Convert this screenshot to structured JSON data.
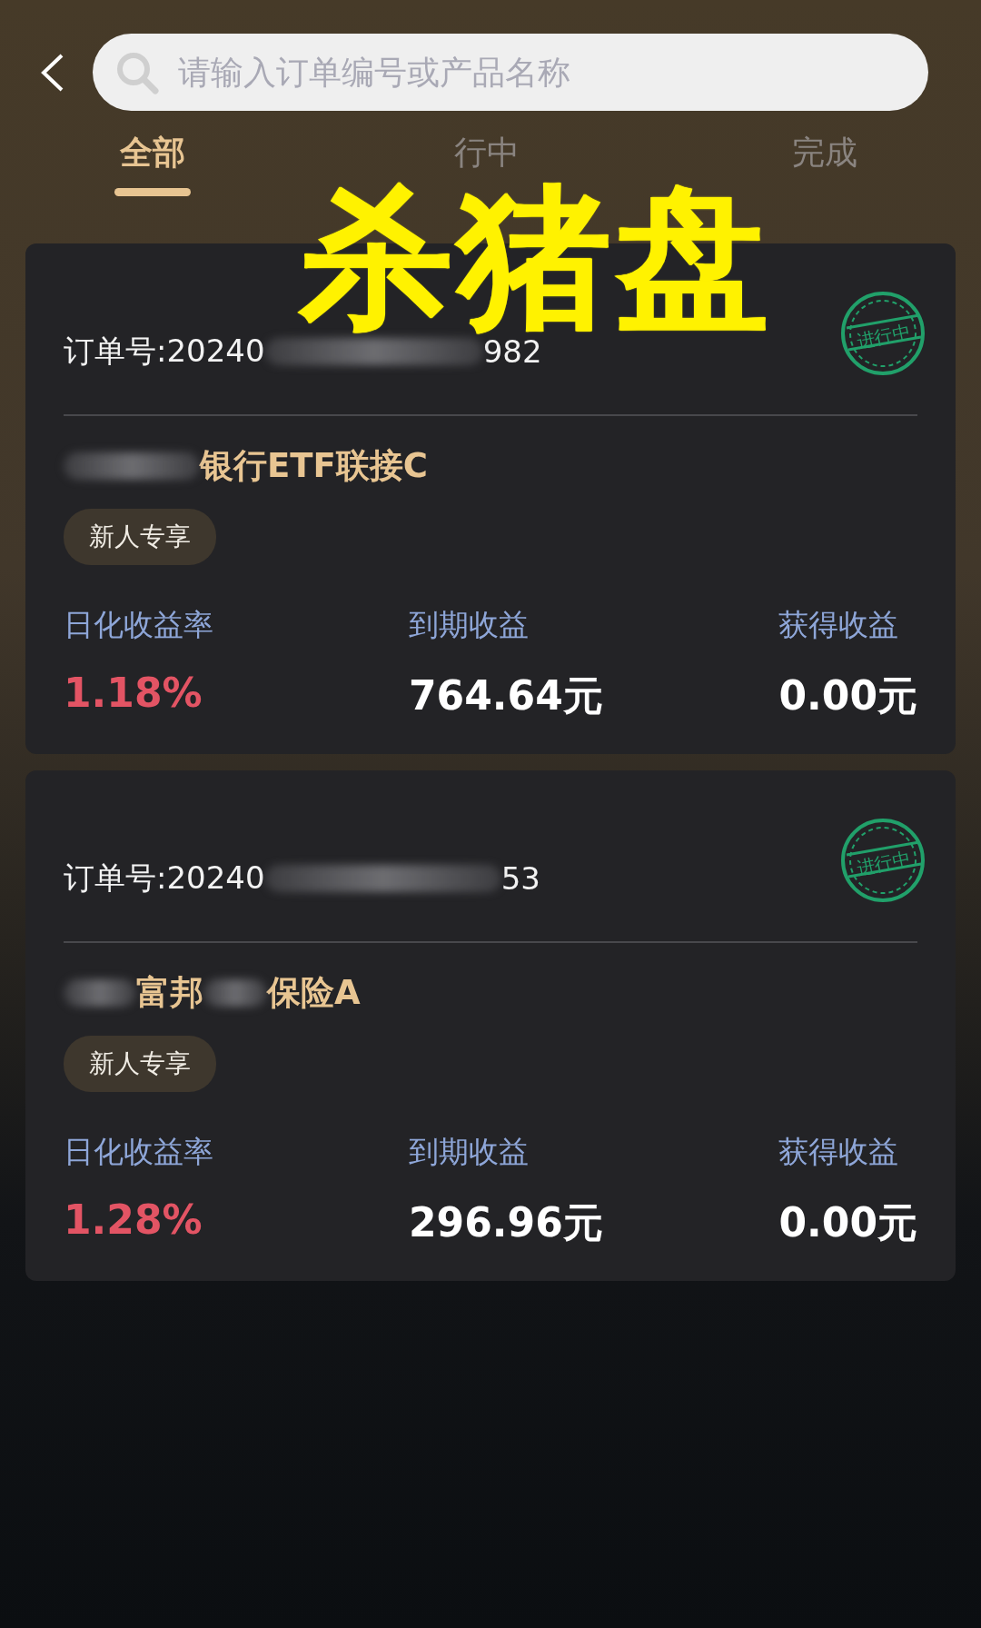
{
  "search": {
    "placeholder": "请输入订单编号或产品名称"
  },
  "tabs": [
    {
      "label": "全部",
      "selected": true
    },
    {
      "label": "行中",
      "selected": false
    },
    {
      "label": "完成",
      "selected": false
    }
  ],
  "overlay": {
    "text": "杀猪盘"
  },
  "orders": [
    {
      "order_prefix": "订单号:20240",
      "order_suffix": "982",
      "status_stamp": "进行中",
      "product": "银行ETF联接C",
      "badge": "新人专享",
      "stats": [
        {
          "label": "日化收益率",
          "value": "1.18%",
          "kind": "rate"
        },
        {
          "label": "到期收益",
          "value": "764.64元",
          "kind": "amount"
        },
        {
          "label": "获得收益",
          "value": "0.00元",
          "kind": "amount"
        }
      ]
    },
    {
      "order_prefix": "订单号:20240",
      "order_suffix": "53",
      "status_stamp": "进行中",
      "product": "富邦",
      "product_tail": "保险A",
      "badge": "新人专享",
      "stats": [
        {
          "label": "日化收益率",
          "value": "1.28%",
          "kind": "rate"
        },
        {
          "label": "到期收益",
          "value": "296.96元",
          "kind": "amount"
        },
        {
          "label": "获得收益",
          "value": "0.00元",
          "kind": "amount"
        }
      ]
    }
  ]
}
